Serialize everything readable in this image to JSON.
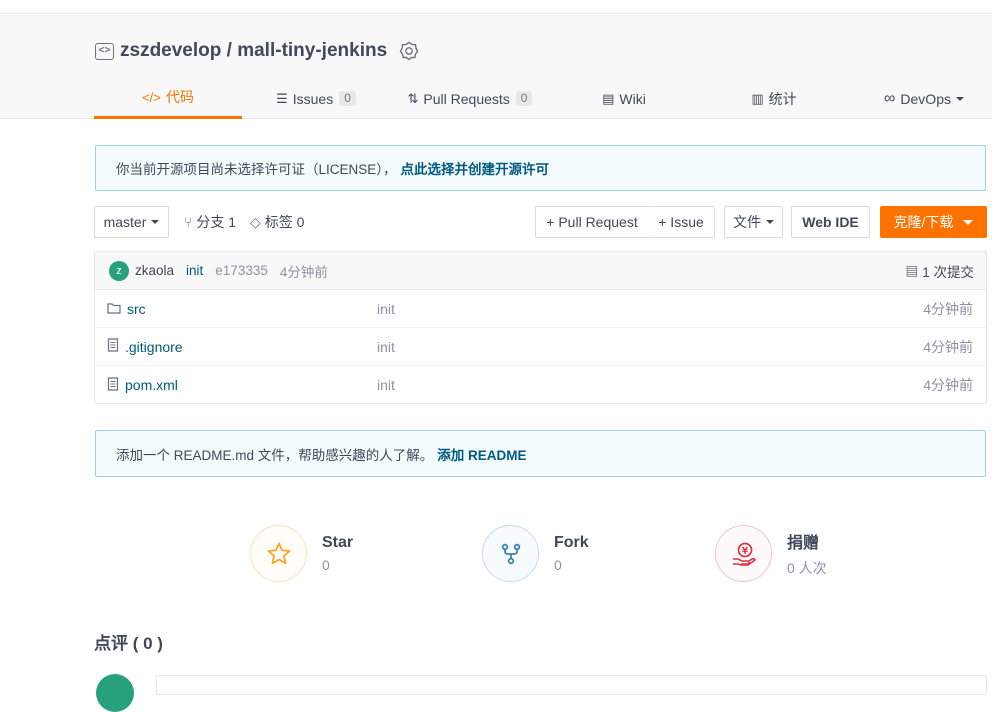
{
  "repo": {
    "owner": "zszdevelop",
    "separator": " / ",
    "name": "mall-tiny-jenkins"
  },
  "tabs": [
    {
      "icon": "</>",
      "label": "代码"
    },
    {
      "icon": "☰",
      "label": "Issues",
      "count": "0"
    },
    {
      "icon": "⇅",
      "label": "Pull Requests",
      "count": "0"
    },
    {
      "icon": "▤",
      "label": "Wiki"
    },
    {
      "icon": "▥",
      "label": "统计"
    },
    {
      "icon": "∞",
      "label": "DevOps"
    }
  ],
  "license_notice": {
    "text": "你当前开源项目尚未选择许可证（LICENSE），",
    "link": "点此选择并创建开源许可"
  },
  "toolbar": {
    "branch": "master",
    "branches_label": "分支 1",
    "tags_label": "标签 0",
    "pull_request_button": "+ Pull Request",
    "issue_button": "+ Issue",
    "file_button": "文件",
    "webide_button": "Web IDE",
    "clone_button": "克隆/下载"
  },
  "latest_commit": {
    "avatar_letter": "z",
    "author": "zkaola",
    "message": "init",
    "hash": "e173335",
    "time": "4分钟前",
    "commits_label": "1 次提交"
  },
  "files": [
    {
      "name": "src",
      "type": "folder",
      "message": "init",
      "time": "4分钟前"
    },
    {
      "name": ".gitignore",
      "type": "file",
      "message": "init",
      "time": "4分钟前"
    },
    {
      "name": "pom.xml",
      "type": "file",
      "message": "init",
      "time": "4分钟前"
    }
  ],
  "readme_notice": {
    "text": "添加一个 README.md 文件，帮助感兴趣的人了解。",
    "link": "添加 README"
  },
  "stats": [
    {
      "label": "Star",
      "value": "0"
    },
    {
      "label": "Fork",
      "value": "0"
    },
    {
      "label": "捐赠",
      "value": "0 人次"
    }
  ],
  "review_title": "点评 ( 0 )",
  "colors": {
    "accent": "#fe7300",
    "link": "#005980",
    "star": "#f6a824",
    "fork": "#3a86b4",
    "donate": "#d9343f"
  }
}
